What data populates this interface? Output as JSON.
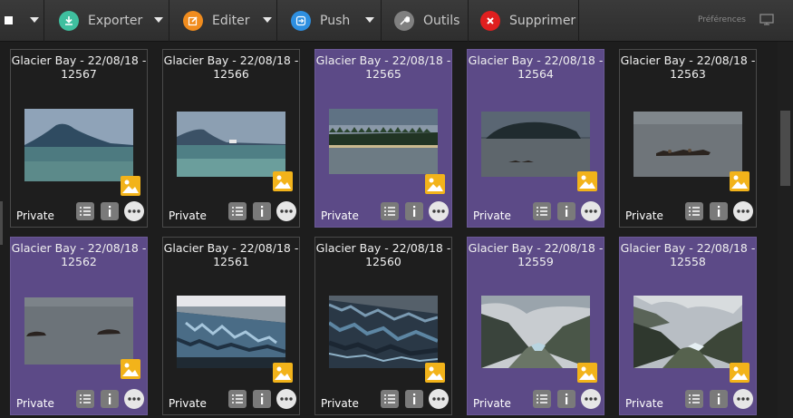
{
  "toolbar": {
    "export_label": "Exporter",
    "edit_label": "Editer",
    "push_label": "Push",
    "tools_label": "Outils",
    "delete_label": "Supprimer",
    "preferences_label": "Préférences",
    "colors": {
      "export": "#3fbf9f",
      "edit": "#f08c1e",
      "push": "#2e8fe0",
      "tools": "#808080",
      "delete": "#e01f1f"
    }
  },
  "cards": [
    {
      "title": "Glacier Bay - 22/08/18 - 12567",
      "privacy": "Private",
      "selected": false,
      "scene": "mountain"
    },
    {
      "title": "Glacier Bay - 22/08/18 - 12566",
      "privacy": "Private",
      "selected": false,
      "scene": "mountain-ship"
    },
    {
      "title": "Glacier Bay - 22/08/18 - 12565",
      "privacy": "Private",
      "selected": true,
      "scene": "forest"
    },
    {
      "title": "Glacier Bay - 22/08/18 - 12564",
      "privacy": "Private",
      "selected": true,
      "scene": "island"
    },
    {
      "title": "Glacier Bay - 22/08/18 - 12563",
      "privacy": "Private",
      "selected": false,
      "scene": "seals"
    },
    {
      "title": "Glacier Bay - 22/08/18 - 12562",
      "privacy": "Private",
      "selected": true,
      "scene": "rocks"
    },
    {
      "title": "Glacier Bay - 22/08/18 - 12561",
      "privacy": "Private",
      "selected": false,
      "scene": "glacier"
    },
    {
      "title": "Glacier Bay - 22/08/18 - 12560",
      "privacy": "Private",
      "selected": false,
      "scene": "glacier-dark"
    },
    {
      "title": "Glacier Bay - 22/08/18 - 12559",
      "privacy": "Private",
      "selected": true,
      "scene": "valley"
    },
    {
      "title": "Glacier Bay - 22/08/18 - 12558",
      "privacy": "Private",
      "selected": true,
      "scene": "valley-cloud"
    }
  ],
  "icons": {
    "list": "list-icon",
    "info": "info-icon",
    "more": "more-icon",
    "type": "image-type-icon"
  }
}
